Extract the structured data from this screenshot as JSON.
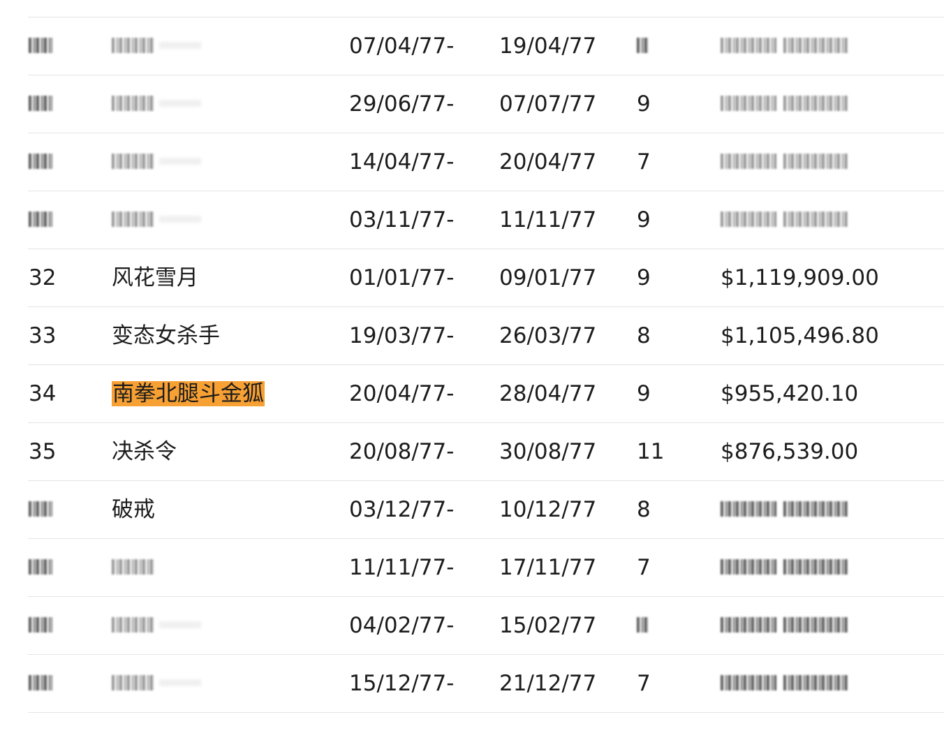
{
  "table": {
    "rows": [
      {
        "rank": "",
        "title": "",
        "start": "07/04/77-",
        "end": "19/04/77",
        "days": "",
        "gross": "",
        "obscured": true
      },
      {
        "rank": "",
        "title": "",
        "start": "29/06/77-",
        "end": "07/07/77",
        "days": "9",
        "gross": "",
        "obscured": true
      },
      {
        "rank": "",
        "title": "",
        "start": "14/04/77-",
        "end": "20/04/77",
        "days": "7",
        "gross": "",
        "obscured": true
      },
      {
        "rank": "",
        "title": "",
        "start": "03/11/77-",
        "end": "11/11/77",
        "days": "9",
        "gross": "",
        "obscured": true
      },
      {
        "rank": "32",
        "title": "风花雪月",
        "start": "01/01/77-",
        "end": "09/01/77",
        "days": "9",
        "gross": "$1,119,909.00"
      },
      {
        "rank": "33",
        "title": "变态女杀手",
        "start": "19/03/77-",
        "end": "26/03/77",
        "days": "8",
        "gross": "$1,105,496.80"
      },
      {
        "rank": "34",
        "title": "南拳北腿斗金狐",
        "start": "20/04/77-",
        "end": "28/04/77",
        "days": "9",
        "gross": "$955,420.10",
        "highlight": true
      },
      {
        "rank": "35",
        "title": "决杀令",
        "start": "20/08/77-",
        "end": "30/08/77",
        "days": "11",
        "gross": "$876,539.00"
      },
      {
        "rank": "",
        "title": "破戒",
        "start": "03/12/77-",
        "end": "10/12/77",
        "days": "8",
        "gross": "",
        "obscured": true
      },
      {
        "rank": "",
        "title": "",
        "start": "11/11/77-",
        "end": "17/11/77",
        "days": "7",
        "gross": "",
        "obscured": true
      },
      {
        "rank": "",
        "title": "",
        "start": "04/02/77-",
        "end": "15/02/77",
        "days": "",
        "gross": "",
        "obscured": true
      },
      {
        "rank": "",
        "title": "",
        "start": "15/12/77-",
        "end": "21/12/77",
        "days": "7",
        "gross": "",
        "obscured": true
      }
    ]
  },
  "colors": {
    "highlight": "#f7a033",
    "row_border": "#e4e4e4",
    "text": "#1c1c1c"
  }
}
